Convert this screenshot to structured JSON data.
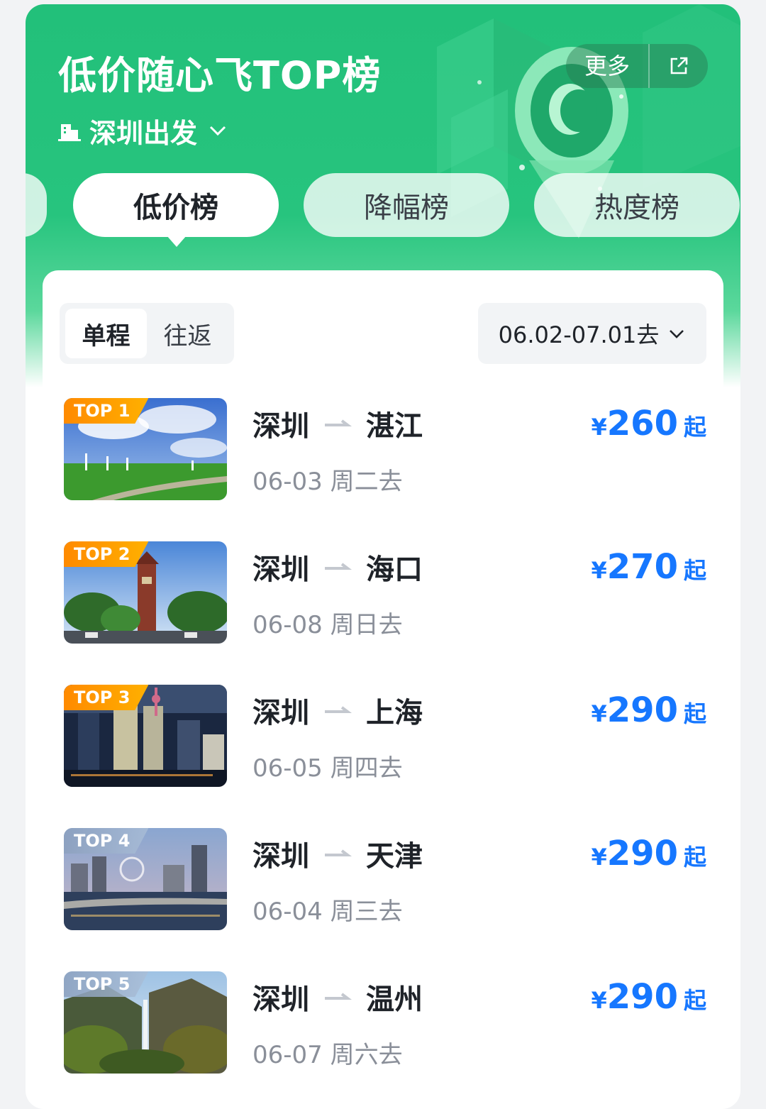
{
  "header": {
    "title": "低价随心飞TOP榜",
    "departure": "深圳出发",
    "more_label": "更多",
    "icons": {
      "city": "building-icon",
      "dropdown": "chevron-down-icon",
      "share": "share-icon"
    }
  },
  "tabs": [
    {
      "label": "低价榜",
      "active": true
    },
    {
      "label": "降幅榜",
      "active": false
    },
    {
      "label": "热度榜",
      "active": false
    }
  ],
  "trip_type": {
    "options": [
      "单程",
      "往返"
    ],
    "selected": "单程"
  },
  "date_range": "06.02-07.01去",
  "colors": {
    "brand_green": "#22c07a",
    "price_blue": "#1677ff",
    "badge_orange": "#ff8a00"
  },
  "rankings": [
    {
      "rank": "TOP 1",
      "from": "深圳",
      "to": "湛江",
      "date": "06-03 周二去",
      "currency": "¥",
      "price": "260",
      "suffix": "起"
    },
    {
      "rank": "TOP 2",
      "from": "深圳",
      "to": "海口",
      "date": "06-08 周日去",
      "currency": "¥",
      "price": "270",
      "suffix": "起"
    },
    {
      "rank": "TOP 3",
      "from": "深圳",
      "to": "上海",
      "date": "06-05 周四去",
      "currency": "¥",
      "price": "290",
      "suffix": "起"
    },
    {
      "rank": "TOP 4",
      "from": "深圳",
      "to": "天津",
      "date": "06-04 周三去",
      "currency": "¥",
      "price": "290",
      "suffix": "起"
    },
    {
      "rank": "TOP 5",
      "from": "深圳",
      "to": "温州",
      "date": "06-07 周六去",
      "currency": "¥",
      "price": "290",
      "suffix": "起"
    }
  ]
}
